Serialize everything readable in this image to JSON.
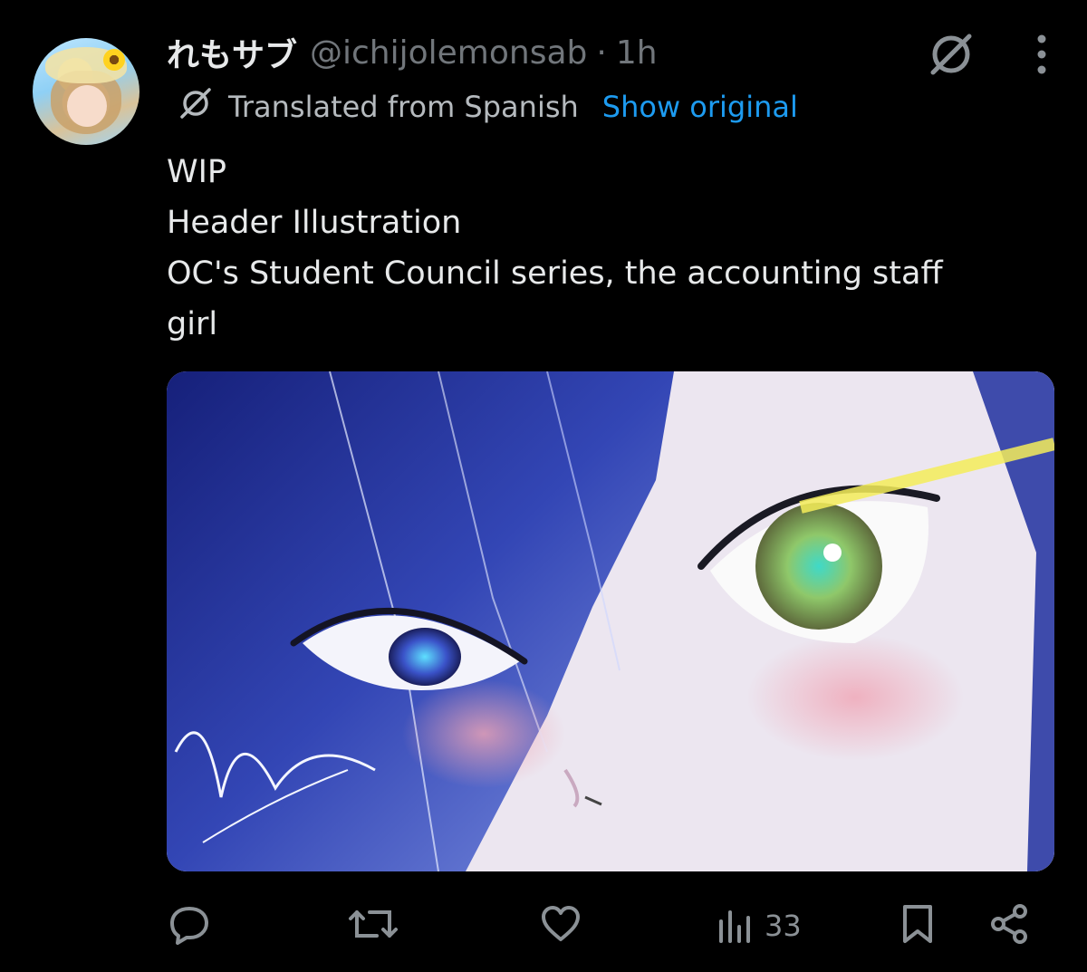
{
  "author": {
    "display_name": "れもサブ",
    "handle": "@ichijolemonsab",
    "separator": "·",
    "time": "1h"
  },
  "translation": {
    "label": "Translated from Spanish",
    "show_original": "Show original"
  },
  "tweet_lines": [
    "WIP",
    "Header Illustration",
    "OC's Student Council series, the accounting staff",
    "girl"
  ],
  "stats": {
    "views": "33"
  },
  "icons": {
    "reply": "reply-icon",
    "retweet": "retweet-icon",
    "like": "heart-icon",
    "views": "views-icon",
    "bookmark": "bookmark-icon",
    "share": "share-icon",
    "grok": "grok-icon",
    "more": "more-vertical-icon",
    "translate": "translate-icon"
  },
  "colors": {
    "background": "#000000",
    "text": "#e7e9ea",
    "secondary": "#71767b",
    "link": "#1d9bf0"
  },
  "media_signature": "Ichijo Lemon"
}
